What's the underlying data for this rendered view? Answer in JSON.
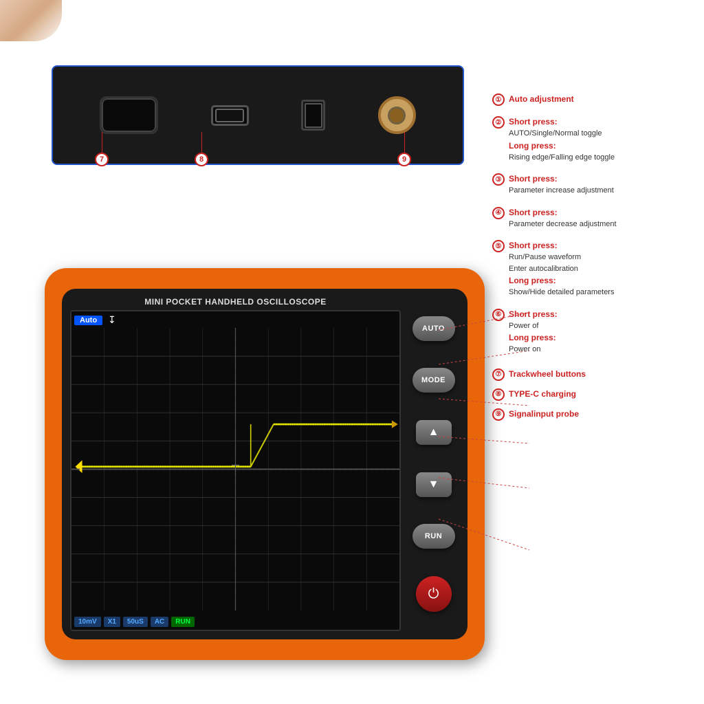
{
  "device": {
    "title": "MINI POCKET HANDHELD OSCILLOSCOPE",
    "screen": {
      "mode": "Auto",
      "trigger_icon": "↧",
      "status_items": [
        "10mV",
        "X1",
        "50uS",
        "AC",
        "RUN"
      ]
    },
    "buttons": [
      "AUTO",
      "MODE",
      "▲",
      "▼",
      "RUN",
      "⏻"
    ],
    "ports": {
      "label7": "⑦",
      "label8": "⑧",
      "label9": "⑨"
    }
  },
  "annotations": {
    "top": [
      {
        "num": "①",
        "main": "Auto adjustment"
      },
      {
        "num": "②",
        "main": "Short press:",
        "sub1": "AUTO/Single/Normal toggle",
        "main2": "Long press:",
        "sub2": "Rising edge/Falling edge toggle"
      },
      {
        "num": "③",
        "main": "Short press:",
        "sub1": "Parameter increase adjustment"
      },
      {
        "num": "④",
        "main": "Short press:",
        "sub1": "Parameter decrease adjustment"
      },
      {
        "num": "⑤",
        "main": "Short press:",
        "sub1": "Run/Pause waveform",
        "sub2": "Enter autocalibration",
        "main2": "Long press:",
        "sub3": "Show/Hide detailed parameters"
      },
      {
        "num": "⑥",
        "main": "Short press:",
        "sub1": "Power of",
        "main2": "Long press:",
        "sub2": "Power on"
      },
      {
        "num": "⑦",
        "main": "Trackwheel buttons"
      },
      {
        "num": "⑧",
        "main": "TYPE-C charging"
      },
      {
        "num": "⑨",
        "main": "Signalinput probe"
      }
    ]
  },
  "top_panel_labels": {
    "7": "7",
    "8": "8",
    "9": "9"
  }
}
